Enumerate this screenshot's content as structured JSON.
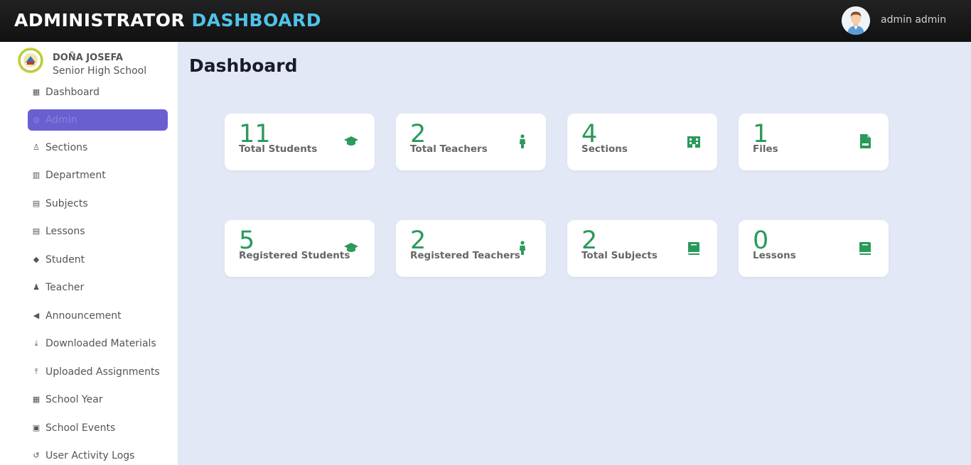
{
  "header": {
    "title_main": "ADMINISTRATOR",
    "title_accent": "DASHBOARD",
    "user_name": "admin admin",
    "accent_color": "#4fc3e8"
  },
  "school": {
    "name_line1": "DOÑA JOSEFA",
    "name_line2": "Senior High School"
  },
  "sidebar": {
    "active_color": "#6a5fcf",
    "items": [
      {
        "label": "Dashboard",
        "icon": "dashboard-icon"
      },
      {
        "label": "Admin",
        "icon": "admin-icon",
        "active": true
      },
      {
        "label": "Sections",
        "icon": "sections-icon"
      },
      {
        "label": "Department",
        "icon": "department-icon"
      },
      {
        "label": "Subjects",
        "icon": "subjects-icon"
      },
      {
        "label": "Lessons",
        "icon": "lessons-icon"
      },
      {
        "label": "Student",
        "icon": "graduation-cap-icon"
      },
      {
        "label": "Teacher",
        "icon": "person-icon"
      },
      {
        "label": "Announcement",
        "icon": "megaphone-icon"
      },
      {
        "label": "Downloaded Materials",
        "icon": "download-icon"
      },
      {
        "label": "Uploaded Assignments",
        "icon": "upload-icon"
      },
      {
        "label": "School Year",
        "icon": "calendar-icon"
      },
      {
        "label": "School Events",
        "icon": "calendar-event-icon"
      },
      {
        "label": "User Activity Logs",
        "icon": "history-icon"
      }
    ]
  },
  "main": {
    "title": "Dashboard",
    "number_color": "#2a9a5b",
    "cards": [
      {
        "value": "11",
        "label": "Total Students",
        "icon": "graduation-cap-icon"
      },
      {
        "value": "2",
        "label": "Total Teachers",
        "icon": "person-icon"
      },
      {
        "value": "4",
        "label": "Sections",
        "icon": "building-icon"
      },
      {
        "value": "1",
        "label": "Files",
        "icon": "file-icon"
      },
      {
        "value": "5",
        "label": "Registered Students",
        "icon": "graduation-cap-icon"
      },
      {
        "value": "2",
        "label": "Registered Teachers",
        "icon": "person-icon"
      },
      {
        "value": "2",
        "label": "Total Subjects",
        "icon": "book-icon"
      },
      {
        "value": "0",
        "label": "Lessons",
        "icon": "book-icon"
      }
    ]
  }
}
